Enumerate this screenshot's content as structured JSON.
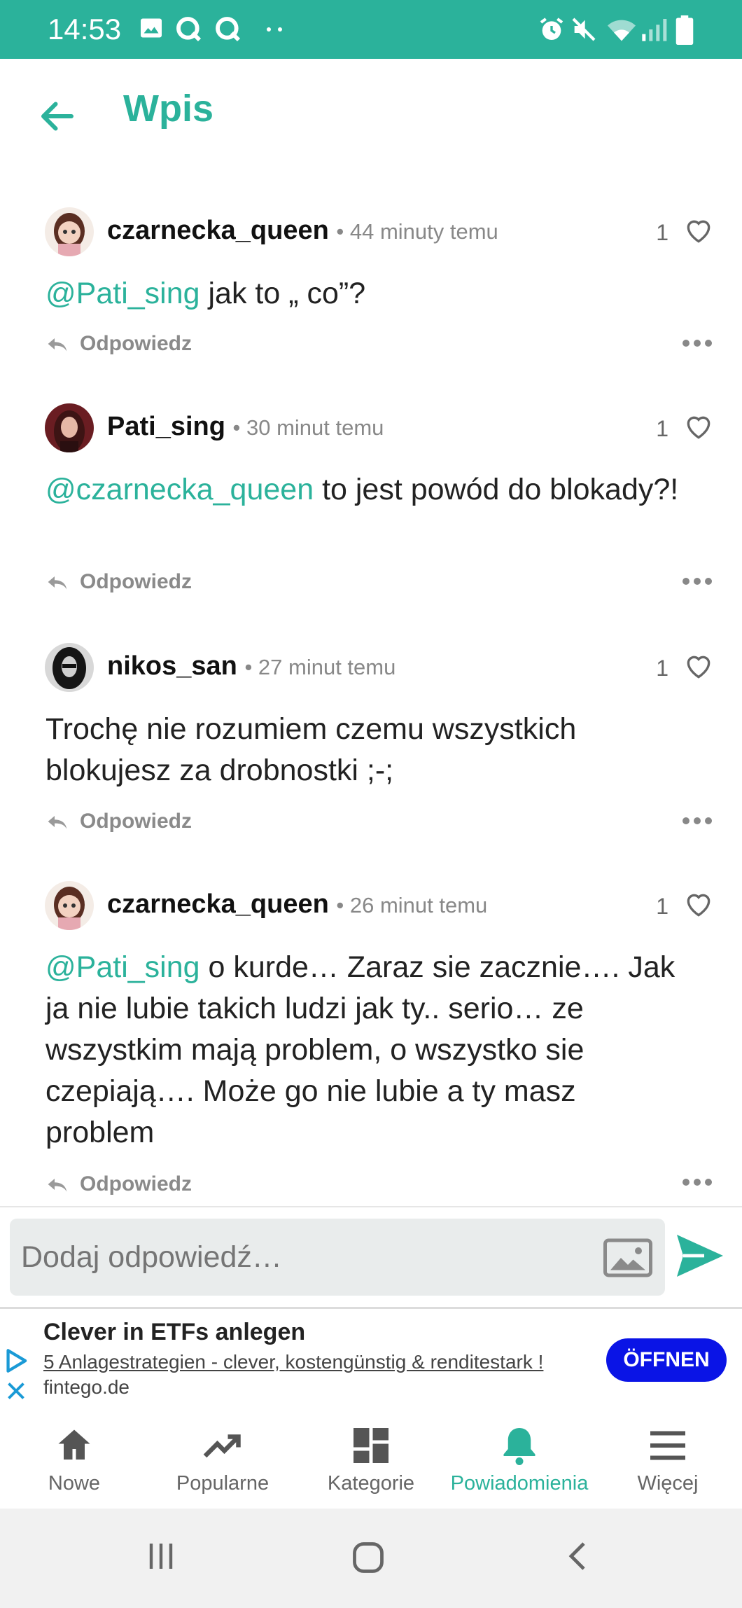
{
  "status_bar": {
    "time": "14:53"
  },
  "app_bar": {
    "title": "Wpis"
  },
  "comments": [
    {
      "username": "czarnecka_queen",
      "time": "• 44 minuty temu",
      "likes": "1",
      "mention": "@Pati_sing",
      "text": " jak to „ co”?",
      "reply": "Odpowiedz"
    },
    {
      "username": "Pati_sing",
      "time": "• 30 minut temu",
      "likes": "1",
      "mention": "@czarnecka_queen",
      "text": " to jest powód do blokady?!",
      "reply": "Odpowiedz"
    },
    {
      "username": "nikos_san",
      "time": "• 27 minut temu",
      "likes": "1",
      "mention": "",
      "text": "Trochę nie rozumiem czemu wszystkich blokujesz za drobnostki ;-;",
      "reply": "Odpowiedz"
    },
    {
      "username": "czarnecka_queen",
      "time": "• 26 minut temu",
      "likes": "1",
      "mention": "@Pati_sing",
      "text": " o kurde… Zaraz sie zacznie…. Jak ja nie lubie takich ludzi jak ty.. serio… ze wszystkim mają problem, o wszystko sie czepiają…. Może go nie lubie a ty masz problem",
      "reply": "Odpowiedz"
    }
  ],
  "reply_input": {
    "placeholder": "Dodaj odpowiedź…"
  },
  "ad": {
    "title": "Clever in ETFs anlegen",
    "subtitle": "5 Anlagestrategien - clever, kostengünstig & renditestark !",
    "domain": "fintego.de",
    "button": "ÖFFNEN"
  },
  "bottom_nav": [
    {
      "label": "Nowe",
      "icon": "home-icon",
      "active": false
    },
    {
      "label": "Popularne",
      "icon": "trending-icon",
      "active": false
    },
    {
      "label": "Kategorie",
      "icon": "grid-icon",
      "active": false
    },
    {
      "label": "Powiadomienia",
      "icon": "bell-icon",
      "active": true
    },
    {
      "label": "Więcej",
      "icon": "menu-icon",
      "active": false
    }
  ],
  "colors": {
    "accent": "#2bb29b",
    "ad_button": "#0a14e6"
  }
}
